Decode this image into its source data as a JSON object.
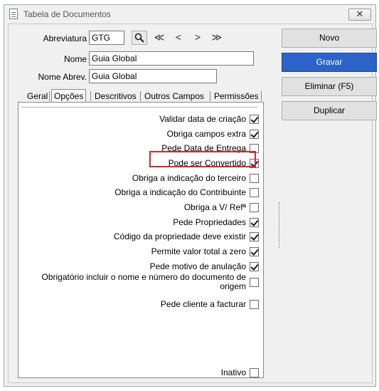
{
  "window": {
    "title": "Tabela de Documentos",
    "close_glyph": "✕"
  },
  "form": {
    "abreviatura_label": "Abreviatura",
    "abreviatura_value": "GTG",
    "nome_label": "Nome",
    "nome_value": "Guia Global",
    "nome_abrev_label": "Nome Abrev.",
    "nome_abrev_value": "Guia Global",
    "nav": {
      "search_icon": "search-icon",
      "first": "≪",
      "prev": "<",
      "next": ">",
      "last": "≫"
    }
  },
  "tabs": [
    {
      "label": "Geral",
      "active": false
    },
    {
      "label": "Opções",
      "active": true
    },
    {
      "label": "Descritivos",
      "active": false
    },
    {
      "label": "Outros Campos",
      "active": false
    },
    {
      "label": "Permissões",
      "active": false
    }
  ],
  "options": [
    {
      "label": "Validar data de criação",
      "checked": true
    },
    {
      "label": "Obriga campos extra",
      "checked": true
    },
    {
      "label": "Pede Data de Entrega",
      "checked": false
    },
    {
      "label": "Pode ser Convertido",
      "checked": true
    },
    {
      "label": "Obriga a indicação do terceiro",
      "checked": false
    },
    {
      "label": "Obriga a indicação do Contribuinte",
      "checked": false
    },
    {
      "label": "Obriga a V/ Refª",
      "checked": false
    },
    {
      "label": "Pede Propriedades",
      "checked": true
    },
    {
      "label": "Código da propriedade deve existir",
      "checked": true
    },
    {
      "label": "Permite valor total a zero",
      "checked": true
    },
    {
      "label": "Pede motivo de anulação",
      "checked": true
    },
    {
      "label": "Obrigatório incluir o nome e número do documento de origem",
      "checked": false
    },
    {
      "label": "Pede cliente a facturar",
      "checked": false
    }
  ],
  "inativo": {
    "label": "Inativo",
    "checked": false
  },
  "buttons": {
    "novo": "Novo",
    "gravar": "Gravar",
    "eliminar": "Eliminar (F5)",
    "duplicar": "Duplicar"
  },
  "colors": {
    "primary_button": "#2d62c9",
    "highlight_border": "#d12a2a"
  }
}
